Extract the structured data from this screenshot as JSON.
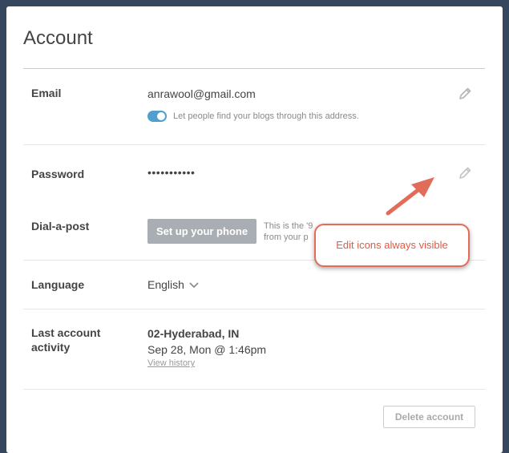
{
  "page": {
    "title": "Account"
  },
  "email": {
    "label": "Email",
    "value": "anrawool@gmail.com",
    "toggle_text": "Let people find your blogs through this address.",
    "toggle_on": true
  },
  "password": {
    "label": "Password",
    "value": "•••••••••••"
  },
  "dial": {
    "label": "Dial-a-post",
    "button": "Set up your phone",
    "desc_line1": "This is the '9",
    "desc_line2": "from your p"
  },
  "language": {
    "label": "Language",
    "value": "English"
  },
  "activity": {
    "label_line1": "Last account",
    "label_line2": "activity",
    "location": "02-Hyderabad, IN",
    "time": "Sep 28, Mon @ 1:46pm",
    "history_link": "View history"
  },
  "footer": {
    "delete_button": "Delete account"
  },
  "annotation": {
    "text": "Edit icons always visible",
    "color": "#e26c5a"
  },
  "icons": {
    "email_edit": "pencil-icon",
    "password_edit": "pencil-icon",
    "language_caret": "chevron-down-icon"
  }
}
